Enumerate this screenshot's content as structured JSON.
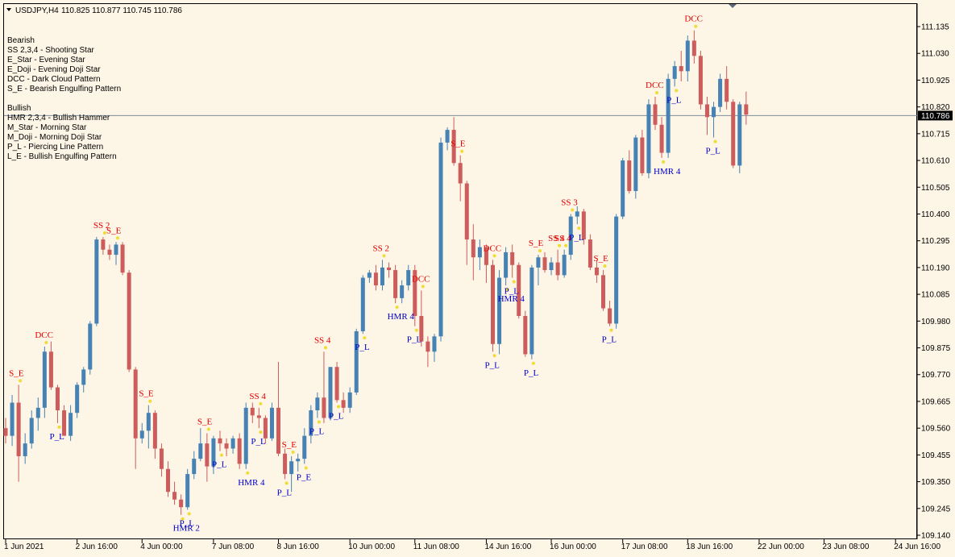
{
  "header": {
    "symbol_label": "USDJPY,H4",
    "ohlc_label": "110.825 110.877 110.745 110.786"
  },
  "legend": {
    "bearish_title": "Bearish",
    "bearish_items": [
      "SS 2,3,4 - Shooting Star",
      "E_Star   - Evening Star",
      "E_Doji   - Evening Doji Star",
      "DCC      - Dark Cloud Pattern",
      "S_E      - Bearish Engulfing Pattern"
    ],
    "bullish_title": "Bullish",
    "bullish_items": [
      "HMR 2,3,4 - Bullish Hammer",
      "M_Star   - Morning Star",
      "M_Doji    - Morning Doji Star",
      "P_L       - Piercing Line Pattern",
      "L_E       - Bullish Engulfing Pattern"
    ]
  },
  "colors": {
    "background": "#fdf5e6",
    "bull": "#4682b4",
    "bear": "#cd5c5c",
    "bear_label": "#e00000",
    "bull_label": "#0000c8",
    "marker": "#f0dc32",
    "price_line": "#7f8c9c",
    "price_tag": "#000000"
  },
  "chart_data": {
    "type": "candlestick",
    "symbol": "USDJPY",
    "timeframe": "H4",
    "current_price": 110.786,
    "ylim": [
      109.13,
      111.2
    ],
    "y_ticks": [
      111.135,
      111.03,
      110.925,
      110.82,
      110.715,
      110.61,
      110.505,
      110.4,
      110.295,
      110.19,
      110.085,
      109.98,
      109.875,
      109.77,
      109.665,
      109.56,
      109.455,
      109.35,
      109.245,
      109.14
    ],
    "y_tick_labels": [
      "111.135",
      "111.030",
      "110.925",
      "110.820",
      "110.715",
      "110.610",
      "110.505",
      "110.400",
      "110.295",
      "110.190",
      "110.085",
      "109.980",
      "109.875",
      "109.770",
      "109.665",
      "109.560",
      "109.455",
      "109.350",
      "109.245",
      "109.140"
    ],
    "current_price_label": "110.786",
    "x_tick_labels": [
      {
        "index": 0,
        "label": "1 Jun 2021"
      },
      {
        "index": 11,
        "label": "2 Jun 16:00"
      },
      {
        "index": 21,
        "label": "4 Jun 00:00"
      },
      {
        "index": 32,
        "label": "7 Jun 08:00"
      },
      {
        "index": 42,
        "label": "8 Jun 16:00"
      },
      {
        "index": 53,
        "label": "10 Jun 00:00"
      },
      {
        "index": 63,
        "label": "11 Jun 08:00"
      },
      {
        "index": 74,
        "label": "14 Jun 16:00"
      },
      {
        "index": 84,
        "label": "16 Jun 00:00"
      },
      {
        "index": 95,
        "label": "17 Jun 08:00"
      },
      {
        "index": 105,
        "label": "18 Jun 16:00"
      },
      {
        "index": 116,
        "label": "22 Jun 00:00"
      },
      {
        "index": 126,
        "label": "23 Jun 08:00"
      },
      {
        "index": 137,
        "label": "24 Jun 16:00"
      }
    ],
    "candles": [
      [
        109.56,
        109.6,
        109.5,
        109.53
      ],
      [
        109.53,
        109.69,
        109.49,
        109.66
      ],
      [
        109.66,
        109.73,
        109.35,
        109.45
      ],
      [
        109.45,
        109.54,
        109.42,
        109.5
      ],
      [
        109.5,
        109.63,
        109.48,
        109.6
      ],
      [
        109.6,
        109.68,
        109.55,
        109.64
      ],
      [
        109.64,
        109.88,
        109.6,
        109.86
      ],
      [
        109.86,
        109.9,
        109.71,
        109.72
      ],
      [
        109.72,
        109.73,
        109.58,
        109.63
      ],
      [
        109.63,
        109.65,
        109.53,
        109.53
      ],
      [
        109.53,
        109.65,
        109.51,
        109.62
      ],
      [
        109.62,
        109.74,
        109.6,
        109.73
      ],
      [
        109.73,
        109.8,
        109.7,
        109.79
      ],
      [
        109.79,
        109.98,
        109.77,
        109.97
      ],
      [
        109.97,
        110.31,
        109.96,
        110.3
      ],
      [
        110.3,
        110.31,
        110.24,
        110.26
      ],
      [
        110.26,
        110.28,
        110.22,
        110.24
      ],
      [
        110.24,
        110.29,
        110.2,
        110.28
      ],
      [
        110.28,
        110.29,
        110.16,
        110.17
      ],
      [
        110.17,
        110.18,
        109.78,
        109.79
      ],
      [
        109.79,
        109.8,
        109.4,
        109.52
      ],
      [
        109.52,
        109.58,
        109.5,
        109.55
      ],
      [
        109.55,
        109.65,
        109.48,
        109.62
      ],
      [
        109.62,
        109.63,
        109.44,
        109.48
      ],
      [
        109.48,
        109.5,
        109.37,
        109.4
      ],
      [
        109.4,
        109.43,
        109.29,
        109.31
      ],
      [
        109.31,
        109.35,
        109.26,
        109.28
      ],
      [
        109.28,
        109.3,
        109.22,
        109.25
      ],
      [
        109.25,
        109.4,
        109.24,
        109.38
      ],
      [
        109.38,
        109.47,
        109.36,
        109.44
      ],
      [
        109.44,
        109.56,
        109.43,
        109.5
      ],
      [
        109.5,
        109.54,
        109.35,
        109.41
      ],
      [
        109.41,
        109.53,
        109.38,
        109.52
      ],
      [
        109.52,
        109.55,
        109.47,
        109.5
      ],
      [
        109.5,
        109.52,
        109.45,
        109.48
      ],
      [
        109.48,
        109.53,
        109.46,
        109.52
      ],
      [
        109.52,
        109.54,
        109.4,
        109.42
      ],
      [
        109.42,
        109.66,
        109.4,
        109.64
      ],
      [
        109.64,
        109.66,
        109.58,
        109.61
      ],
      [
        109.61,
        109.64,
        109.56,
        109.6
      ],
      [
        109.6,
        109.61,
        109.5,
        109.52
      ],
      [
        109.52,
        109.66,
        109.51,
        109.64
      ],
      [
        109.64,
        109.82,
        109.45,
        109.46
      ],
      [
        109.46,
        109.48,
        109.36,
        109.38
      ],
      [
        109.38,
        109.45,
        109.31,
        109.43
      ],
      [
        109.43,
        109.46,
        109.39,
        109.44
      ],
      [
        109.44,
        109.56,
        109.42,
        109.53
      ],
      [
        109.53,
        109.65,
        109.5,
        109.63
      ],
      [
        109.63,
        109.7,
        109.6,
        109.68
      ],
      [
        109.68,
        109.86,
        109.58,
        109.6
      ],
      [
        109.6,
        109.8,
        109.59,
        109.8
      ],
      [
        109.8,
        109.82,
        109.66,
        109.67
      ],
      [
        109.67,
        109.7,
        109.62,
        109.64
      ],
      [
        109.64,
        109.72,
        109.62,
        109.7
      ],
      [
        109.7,
        109.95,
        109.69,
        109.94
      ],
      [
        109.94,
        110.16,
        109.93,
        110.15
      ],
      [
        110.15,
        110.18,
        110.13,
        110.17
      ],
      [
        110.17,
        110.2,
        110.1,
        110.12
      ],
      [
        110.12,
        110.22,
        110.1,
        110.19
      ],
      [
        110.19,
        110.21,
        110.15,
        110.18
      ],
      [
        110.18,
        110.2,
        110.05,
        110.07
      ],
      [
        110.07,
        110.14,
        110.05,
        110.12
      ],
      [
        110.12,
        110.2,
        110.1,
        110.18
      ],
      [
        110.18,
        110.2,
        109.96,
        110.0
      ],
      [
        110.0,
        110.1,
        109.88,
        109.9
      ],
      [
        109.9,
        109.92,
        109.8,
        109.86
      ],
      [
        109.86,
        109.93,
        109.82,
        109.92
      ],
      [
        109.92,
        110.7,
        109.9,
        110.68
      ],
      [
        110.68,
        110.74,
        110.65,
        110.73
      ],
      [
        110.73,
        110.78,
        110.59,
        110.6
      ],
      [
        110.6,
        110.63,
        110.45,
        110.52
      ],
      [
        110.52,
        110.53,
        110.2,
        110.3
      ],
      [
        110.3,
        110.36,
        110.14,
        110.23
      ],
      [
        110.23,
        110.3,
        110.18,
        110.27
      ],
      [
        110.27,
        110.28,
        110.13,
        110.2
      ],
      [
        110.2,
        110.22,
        109.86,
        109.89
      ],
      [
        109.89,
        110.18,
        109.85,
        110.15
      ],
      [
        110.15,
        110.27,
        110.12,
        110.25
      ],
      [
        110.25,
        110.28,
        110.15,
        110.2
      ],
      [
        110.2,
        110.21,
        109.99,
        110.0
      ],
      [
        110.0,
        110.02,
        109.84,
        109.85
      ],
      [
        109.85,
        110.2,
        109.83,
        110.19
      ],
      [
        110.19,
        110.24,
        110.12,
        110.23
      ],
      [
        110.23,
        110.25,
        110.17,
        110.18
      ],
      [
        110.18,
        110.23,
        110.16,
        110.21
      ],
      [
        110.21,
        110.26,
        110.14,
        110.16
      ],
      [
        110.16,
        110.26,
        110.15,
        110.24
      ],
      [
        110.24,
        110.4,
        110.22,
        110.39
      ],
      [
        110.39,
        110.43,
        110.36,
        110.41
      ],
      [
        110.41,
        110.42,
        110.28,
        110.3
      ],
      [
        110.3,
        110.32,
        110.18,
        110.19
      ],
      [
        110.19,
        110.22,
        110.13,
        110.16
      ],
      [
        110.16,
        110.18,
        110.02,
        110.03
      ],
      [
        110.03,
        110.06,
        109.96,
        109.97
      ],
      [
        109.97,
        110.4,
        109.95,
        110.39
      ],
      [
        110.39,
        110.62,
        110.38,
        110.61
      ],
      [
        110.61,
        110.65,
        110.48,
        110.49
      ],
      [
        110.49,
        110.71,
        110.46,
        110.7
      ],
      [
        110.7,
        110.73,
        110.55,
        110.56
      ],
      [
        110.56,
        110.85,
        110.54,
        110.83
      ],
      [
        110.83,
        110.86,
        110.73,
        110.75
      ],
      [
        110.75,
        110.78,
        110.62,
        110.64
      ],
      [
        110.64,
        110.95,
        110.62,
        110.93
      ],
      [
        110.93,
        111.0,
        110.9,
        110.98
      ],
      [
        110.98,
        111.04,
        110.92,
        110.96
      ],
      [
        110.96,
        111.1,
        110.92,
        111.08
      ],
      [
        111.08,
        111.12,
        110.99,
        111.02
      ],
      [
        111.02,
        111.04,
        110.81,
        110.83
      ],
      [
        110.83,
        110.86,
        110.71,
        110.78
      ],
      [
        110.78,
        110.84,
        110.7,
        110.82
      ],
      [
        110.82,
        110.95,
        110.8,
        110.93
      ],
      [
        110.93,
        110.98,
        110.81,
        110.84
      ],
      [
        110.84,
        110.85,
        110.58,
        110.59
      ],
      [
        110.59,
        110.84,
        110.56,
        110.83
      ],
      [
        110.83,
        110.88,
        110.75,
        110.79
      ]
    ]
  },
  "annotations": [
    {
      "index": 2,
      "text": "S_E",
      "kind": "bear"
    },
    {
      "index": 8,
      "text": "P_L",
      "kind": "bull"
    },
    {
      "index": 6,
      "text": "DCC",
      "kind": "bear"
    },
    {
      "index": 15,
      "text": "SS 2",
      "kind": "bear"
    },
    {
      "index": 17,
      "text": "S_E",
      "kind": "bear"
    },
    {
      "index": 22,
      "text": "S_E",
      "kind": "bear"
    },
    {
      "index": 27,
      "text": "HMR 2",
      "kind": "bull"
    },
    {
      "index": 28,
      "text": "P_L",
      "kind": "bull"
    },
    {
      "index": 31,
      "text": "S_E",
      "kind": "bear"
    },
    {
      "index": 33,
      "text": "P_L",
      "kind": "bull"
    },
    {
      "index": 37,
      "text": "HMR 4",
      "kind": "bull"
    },
    {
      "index": 39,
      "text": "SS 4",
      "kind": "bear"
    },
    {
      "index": 39,
      "text": "P_L",
      "kind": "bull"
    },
    {
      "index": 43,
      "text": "P_L",
      "kind": "bull"
    },
    {
      "index": 44,
      "text": "S_E",
      "kind": "bear"
    },
    {
      "index": 46,
      "text": "P_E",
      "kind": "bull"
    },
    {
      "index": 48,
      "text": "P_L",
      "kind": "bull"
    },
    {
      "index": 49,
      "text": "SS 4",
      "kind": "bear"
    },
    {
      "index": 51,
      "text": "P_L",
      "kind": "bull"
    },
    {
      "index": 55,
      "text": "P_L",
      "kind": "bull"
    },
    {
      "index": 58,
      "text": "SS 2",
      "kind": "bear"
    },
    {
      "index": 60,
      "text": "HMR 4",
      "kind": "bull"
    },
    {
      "index": 63,
      "text": "P_L",
      "kind": "bull"
    },
    {
      "index": 64,
      "text": "DCC",
      "kind": "bear"
    },
    {
      "index": 70,
      "text": "S_E",
      "kind": "bear"
    },
    {
      "index": 75,
      "text": "DCC",
      "kind": "bear"
    },
    {
      "index": 75,
      "text": "P_L",
      "kind": "bull"
    },
    {
      "index": 77,
      "text": "HMR 4",
      "kind": "bull"
    },
    {
      "index": 78,
      "text": "P_L",
      "kind": "bull"
    },
    {
      "index": 81,
      "text": "P_L",
      "kind": "bull"
    },
    {
      "index": 82,
      "text": "S_E",
      "kind": "bear"
    },
    {
      "index": 85,
      "text": "SS 4",
      "kind": "bear"
    },
    {
      "index": 86,
      "text": "SS 4",
      "kind": "bear"
    },
    {
      "index": 87,
      "text": "SS 3",
      "kind": "bear"
    },
    {
      "index": 88,
      "text": "P_L",
      "kind": "bull"
    },
    {
      "index": 92,
      "text": "S_E",
      "kind": "bear"
    },
    {
      "index": 93,
      "text": "P_L",
      "kind": "bull"
    },
    {
      "index": 100,
      "text": "DCC",
      "kind": "bear"
    },
    {
      "index": 101,
      "text": "HMR 4",
      "kind": "bull"
    },
    {
      "index": 103,
      "text": "P_L",
      "kind": "bull"
    },
    {
      "index": 106,
      "text": "DCC",
      "kind": "bear"
    },
    {
      "index": 109,
      "text": "P_L",
      "kind": "bull"
    }
  ]
}
